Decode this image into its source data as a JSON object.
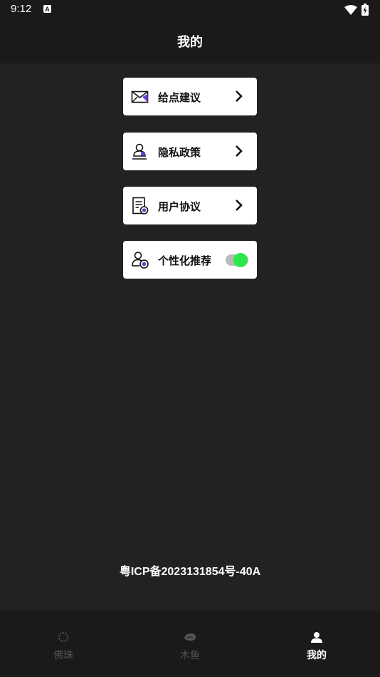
{
  "status_bar": {
    "time": "9:12",
    "notification_icon": "a-icon",
    "wifi_icon": "wifi-icon",
    "battery_icon": "battery-charging-icon"
  },
  "app_bar": {
    "title": "我的"
  },
  "menu": {
    "items": [
      {
        "label": "给点建议",
        "icon": "envelope-icon",
        "trailing": "chevron-right-icon"
      },
      {
        "label": "隐私政策",
        "icon": "user-stamp-icon",
        "trailing": "chevron-right-icon"
      },
      {
        "label": "用户协议",
        "icon": "document-icon",
        "trailing": "chevron-right-icon"
      },
      {
        "label": "个性化推荐",
        "icon": "user-settings-icon",
        "trailing": "toggle",
        "toggle_on": true
      }
    ]
  },
  "footer": {
    "icp": "粤ICP备2023131854号-40A"
  },
  "bottom_nav": {
    "items": [
      {
        "label": "佛珠",
        "icon": "beads-icon",
        "active": false
      },
      {
        "label": "木鱼",
        "icon": "wooden-fish-icon",
        "active": false
      },
      {
        "label": "我的",
        "icon": "person-icon",
        "active": true
      }
    ]
  },
  "colors": {
    "background": "#222222",
    "bar": "#1a1a1a",
    "card": "#ffffff",
    "accent_purple": "#6a3fd1",
    "toggle_on": "#2ee84a",
    "nav_inactive": "#555555"
  }
}
